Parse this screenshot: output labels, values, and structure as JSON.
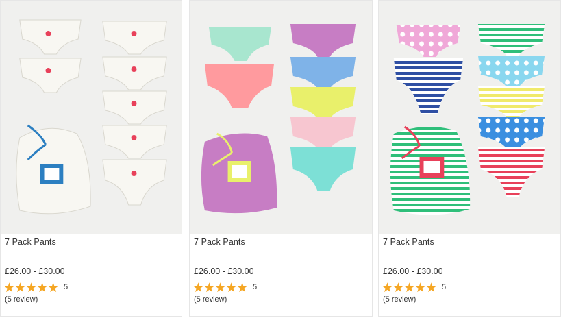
{
  "products": [
    {
      "name": "7 Pack Pants",
      "price": "£26.00 - £30.00",
      "stars": "★★★★★",
      "rating_count": "5",
      "review_text": "(5 review)",
      "image_theme": "white-ballerina",
      "palette": [
        "#f7f5ef",
        "#2c7fc1",
        "#e8415a"
      ]
    },
    {
      "name": "7 Pack Pants",
      "price": "£26.00 - £30.00",
      "stars": "★★★★★",
      "rating_count": "5",
      "review_text": "(5 review)",
      "image_theme": "floral-pastels",
      "palette": [
        "#a8e6cf",
        "#ff9a9e",
        "#7fb3e8",
        "#e9f06b",
        "#f7c6d0",
        "#7de0d6",
        "#c77dc4"
      ]
    },
    {
      "name": "7 Pack Pants",
      "price": "£26.00 - £30.00",
      "stars": "★★★★★",
      "rating_count": "5",
      "review_text": "(5 review)",
      "image_theme": "stripes-spots",
      "palette": [
        "#f0a8d8",
        "#2f4fa3",
        "#2fbf7a",
        "#8ad7ef",
        "#f0ea6b",
        "#3b8fe0",
        "#e8415a"
      ]
    }
  ]
}
